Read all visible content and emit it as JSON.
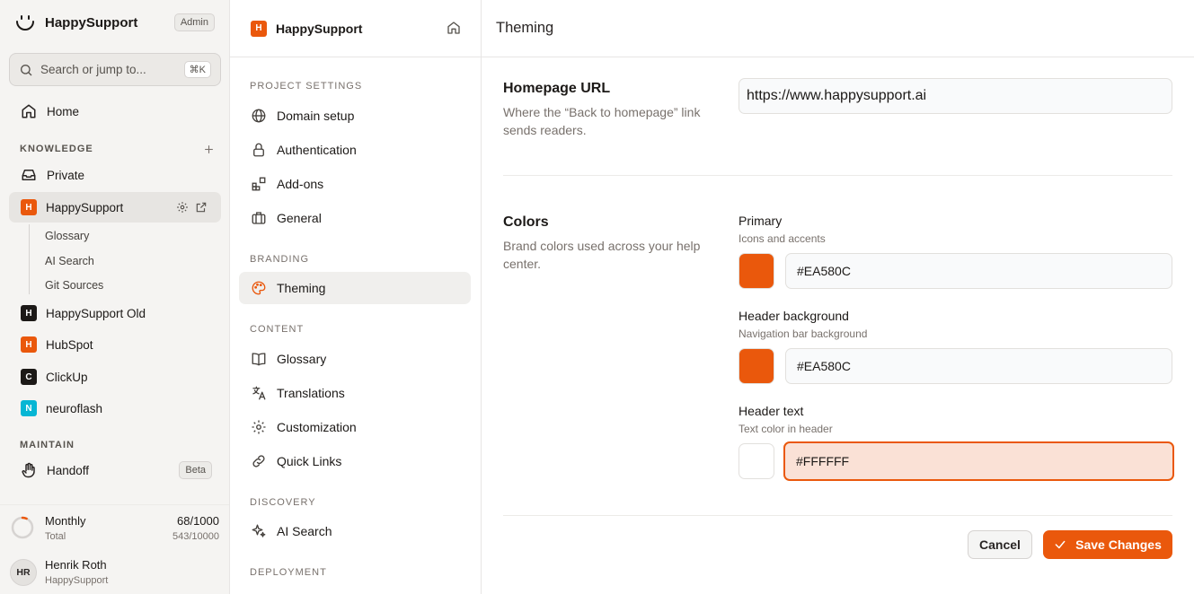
{
  "app": {
    "name": "HappySupport",
    "role_badge": "Admin",
    "accent_color": "#EA580C"
  },
  "search": {
    "placeholder": "Search or jump to...",
    "shortcut": "⌘K"
  },
  "sidebar": {
    "home_label": "Home",
    "knowledge_section": "KNOWLEDGE",
    "private_label": "Private",
    "projects": [
      {
        "badge": "H",
        "label": "HappySupport",
        "color": "#EA580C",
        "active": true
      },
      {
        "badge": "H",
        "label": "HappySupport Old",
        "color": "#1C1917"
      },
      {
        "badge": "H",
        "label": "HubSpot",
        "color": "#EA580C"
      },
      {
        "badge": "C",
        "label": "ClickUp",
        "color": "#1C1917"
      },
      {
        "badge": "N",
        "label": "neuroflash",
        "color": "#06B6D4"
      }
    ],
    "subitems": [
      "Glossary",
      "AI Search",
      "Git Sources"
    ],
    "maintain_section": "MAINTAIN",
    "handoff_label": "Handoff",
    "beta_badge": "Beta",
    "usage": {
      "label": "Monthly",
      "value": "68/1000",
      "sub_label": "Total",
      "sub_value": "543/10000",
      "fraction": 0.068
    },
    "user": {
      "initials": "HR",
      "name": "Henrik Roth",
      "org": "HappySupport"
    }
  },
  "projnav": {
    "title": "HappySupport",
    "badge": "H",
    "sections": {
      "project_settings": "PROJECT SETTINGS",
      "branding": "BRANDING",
      "content": "CONTENT",
      "discovery": "DISCOVERY",
      "deployment": "DEPLOYMENT"
    },
    "items": {
      "domain_setup": "Domain setup",
      "authentication": "Authentication",
      "addons": "Add-ons",
      "general": "General",
      "theming": "Theming",
      "glossary": "Glossary",
      "translations": "Translations",
      "customization": "Customization",
      "quick_links": "Quick Links",
      "ai_search": "AI Search"
    }
  },
  "main": {
    "title": "Theming",
    "homepage": {
      "title": "Homepage URL",
      "description": "Where the “Back to homepage” link sends readers.",
      "value": "https://www.happysupport.ai"
    },
    "colors": {
      "title": "Colors",
      "description": "Brand colors used across your help center.",
      "primary": {
        "label": "Primary",
        "hint": "Icons and accents",
        "value": "#EA580C"
      },
      "header_background": {
        "label": "Header background",
        "hint": "Navigation bar background",
        "value": "#EA580C"
      },
      "header_text": {
        "label": "Header text",
        "hint": "Text color in header",
        "value": "#FFFFFF"
      }
    },
    "cancel_label": "Cancel",
    "save_label": "Save Changes"
  }
}
